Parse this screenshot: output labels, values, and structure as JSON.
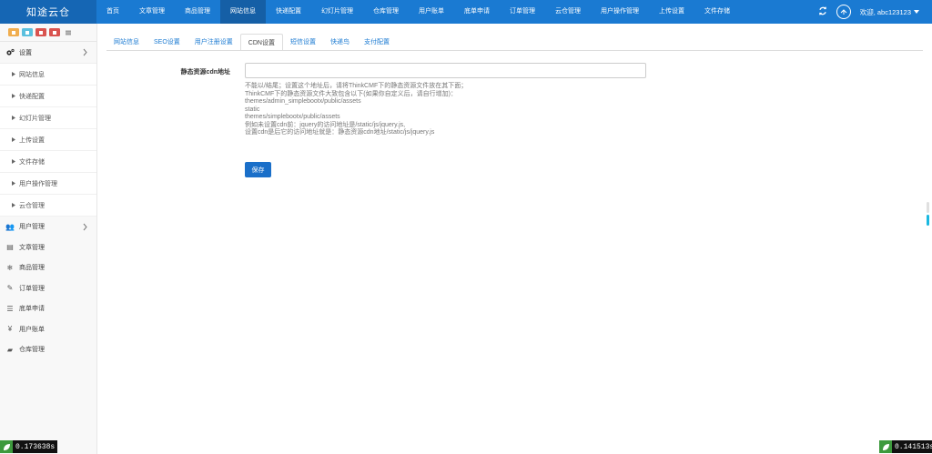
{
  "brand": "知途云仓",
  "top_nav": [
    {
      "label": "首页",
      "active": false
    },
    {
      "label": "文章管理",
      "active": false
    },
    {
      "label": "商品管理",
      "active": false
    },
    {
      "label": "网站信息",
      "active": true
    },
    {
      "label": "快递配置",
      "active": false
    },
    {
      "label": "幻灯片管理",
      "active": false
    },
    {
      "label": "仓库管理",
      "active": false
    },
    {
      "label": "用户账单",
      "active": false
    },
    {
      "label": "底单申请",
      "active": false
    },
    {
      "label": "订单管理",
      "active": false
    },
    {
      "label": "云仓管理",
      "active": false
    },
    {
      "label": "用户操作管理",
      "active": false
    },
    {
      "label": "上传设置",
      "active": false
    },
    {
      "label": "文件存储",
      "active": false
    }
  ],
  "user": {
    "greeting": "欢迎, abc123123"
  },
  "sidebar": {
    "shortcut_colors": [
      "#f0ad4e",
      "#5bc0de",
      "#d9534f",
      "#d9534f"
    ],
    "settings_group": "设置",
    "settings_sub": [
      "网站信息",
      "快递配置",
      "幻灯片管理",
      "上传设置",
      "文件存储",
      "用户操作管理",
      "云仓管理"
    ],
    "items": [
      {
        "label": "用户管理",
        "icon": "users-icon",
        "has_children": true
      },
      {
        "label": "文章管理",
        "icon": "newspaper-icon",
        "has_children": false
      },
      {
        "label": "商品管理",
        "icon": "snowflake-icon",
        "has_children": false
      },
      {
        "label": "订单管理",
        "icon": "edit-icon",
        "has_children": false
      },
      {
        "label": "底单申请",
        "icon": "bars-icon",
        "has_children": false
      },
      {
        "label": "用户账单",
        "icon": "yen-icon",
        "has_children": false
      },
      {
        "label": "仓库管理",
        "icon": "truck-icon",
        "has_children": false
      }
    ]
  },
  "tabs": [
    {
      "label": "网站信息",
      "active": false
    },
    {
      "label": "SEO设置",
      "active": false
    },
    {
      "label": "用户注册设置",
      "active": false
    },
    {
      "label": "CDN设置",
      "active": true
    },
    {
      "label": "短信设置",
      "active": false
    },
    {
      "label": "快递鸟",
      "active": false
    },
    {
      "label": "支付配置",
      "active": false
    }
  ],
  "form": {
    "cdn_label": "静态资源cdn地址",
    "cdn_value": "",
    "help_lines": [
      "不能以/结尾；设置这个地址后，请将ThinkCMF下的静态资源文件放在其下面；",
      "ThinkCMF下的静态资源文件大致包含以下(如果你自定义后，请自行增加)：",
      "themes/admin_simplebootx/public/assets",
      "static",
      "themes/simplebootx/public/assets",
      "例如未设置cdn前：jquery的访问地址是/static/js/jquery.js,",
      "设置cdn是后它的访问地址就是：静态资源cdn地址/static/js/jquery.js"
    ],
    "save_label": "保存"
  },
  "perf": {
    "left": "0.173638s",
    "right": "0.141513s"
  },
  "colors": {
    "topbar": "#1a7ad2",
    "brand_bg": "#1566b4",
    "active_nav": "#155fa6",
    "primary_button": "#1a6fc9"
  }
}
